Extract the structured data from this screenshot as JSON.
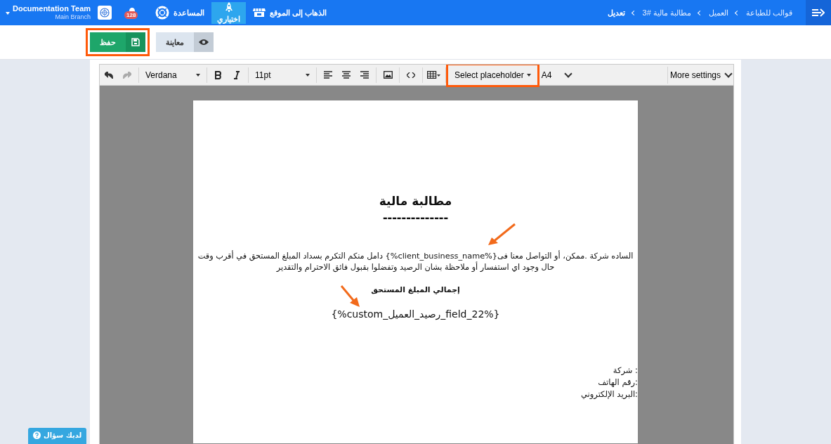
{
  "topbar": {
    "account": {
      "name": "Documentation Team",
      "branch": "Main Branch"
    },
    "notifications": {
      "count": "128"
    },
    "nav": [
      {
        "kind": "help",
        "label": "المساعدة",
        "selected": false
      },
      {
        "kind": "rocket",
        "label": "اختياري",
        "selected": true
      },
      {
        "kind": "store",
        "label": "الذهاب إلى الموقع",
        "selected": false
      }
    ],
    "breadcrumbs": [
      "قوالب للطباعة",
      "العميل",
      "مطالبة مالية #3",
      "تعديل"
    ]
  },
  "actions": [
    {
      "kind": "preview",
      "label": "معاينة",
      "highlighted": false
    },
    {
      "kind": "save",
      "label": "حفظ",
      "highlighted": true
    }
  ],
  "toolbar": {
    "font": "Verdana",
    "size": "11pt",
    "placeholder_menu": {
      "label": "Select placeholder",
      "highlighted": true
    },
    "paper": "A4",
    "more": "More settings"
  },
  "document": {
    "title": "مطالبة مالية",
    "rule": "--------------",
    "paragraph_lines": [
      {
        "text": "الساده شركة .ممكن، أو التواصل معنا فى{%client_business_name%} دامل منكم التكرم بسداد المبلغ المستحق في أقرب وقت",
        "arrow": true
      },
      {
        "text": "حال وجود اي استفسار أو ملاحظة بشان الرصيد وتفضلوا بقبول فائق الاحترام والتقدير",
        "arrow": false
      }
    ],
    "subtitle": "إجمالي المبلغ المستحق",
    "field": {
      "text": "{%custom_رصيد_العميل_field_22%}",
      "arrow": true
    },
    "contact_lines": [
      ": شركة",
      ":رقم الهاتف",
      ":البريد الإلكتروني"
    ]
  },
  "help_button": {
    "label": "لديك سؤال"
  }
}
